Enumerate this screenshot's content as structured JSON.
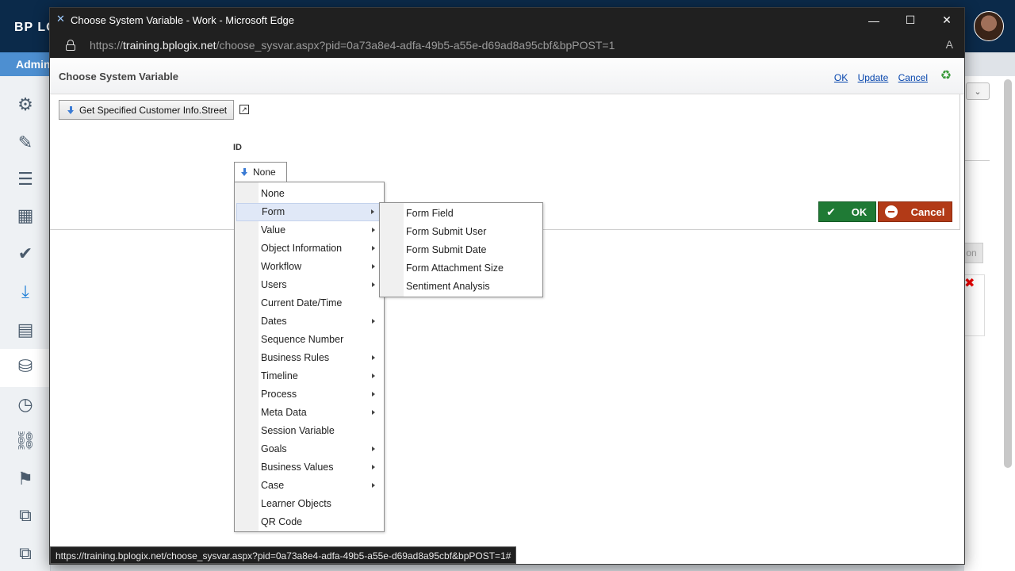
{
  "app": {
    "logo_text": "BP LO",
    "admin_label": "Admin"
  },
  "window": {
    "title": "Choose System Variable - Work - Microsoft Edge",
    "url_prefix": "https://",
    "url_host": "training.bplogix.net",
    "url_path": "/choose_sysvar.aspx?pid=0a73a8e4-adfa-49b5-a55e-d69ad8a95cbf&bpPOST=1",
    "minimize_glyph": "—",
    "maximize_glyph": "☐",
    "close_glyph": "✕",
    "read_aloud_glyph": "A"
  },
  "dialog": {
    "title": "Choose System Variable",
    "links": {
      "ok": "OK",
      "update": "Update",
      "cancel": "Cancel"
    },
    "path_button": "Get Specified Customer Info.Street",
    "id_label": "ID",
    "id_value": "None",
    "ok_button": "OK",
    "cancel_button": "Cancel"
  },
  "menu": {
    "items": [
      {
        "label": "None",
        "submenu": false
      },
      {
        "label": "Form",
        "submenu": true,
        "highlighted": true
      },
      {
        "label": "Value",
        "submenu": true
      },
      {
        "label": "Object Information",
        "submenu": true
      },
      {
        "label": "Workflow",
        "submenu": true
      },
      {
        "label": "Users",
        "submenu": true
      },
      {
        "label": "Current Date/Time",
        "submenu": false
      },
      {
        "label": "Dates",
        "submenu": true
      },
      {
        "label": "Sequence Number",
        "submenu": false
      },
      {
        "label": "Business Rules",
        "submenu": true
      },
      {
        "label": "Timeline",
        "submenu": true
      },
      {
        "label": "Process",
        "submenu": true
      },
      {
        "label": "Meta Data",
        "submenu": true
      },
      {
        "label": "Session Variable",
        "submenu": false
      },
      {
        "label": "Goals",
        "submenu": true
      },
      {
        "label": "Business Values",
        "submenu": true
      },
      {
        "label": "Case",
        "submenu": true
      },
      {
        "label": "Learner Objects",
        "submenu": false
      },
      {
        "label": "QR Code",
        "submenu": false
      }
    ]
  },
  "submenu": {
    "items": [
      {
        "label": "Form Field"
      },
      {
        "label": "Form Submit User"
      },
      {
        "label": "Form Submit Date"
      },
      {
        "label": "Form Attachment Size"
      },
      {
        "label": "Sentiment Analysis"
      }
    ]
  },
  "statusbar": {
    "text": "https://training.bplogix.net/choose_sysvar.aspx?pid=0a73a8e4-adfa-49b5-a55e-d69ad8a95cbf&bpPOST=1#"
  },
  "background": {
    "right_button_text": "on",
    "right_select_glyph": "⌄",
    "delete_glyph": "✖"
  }
}
